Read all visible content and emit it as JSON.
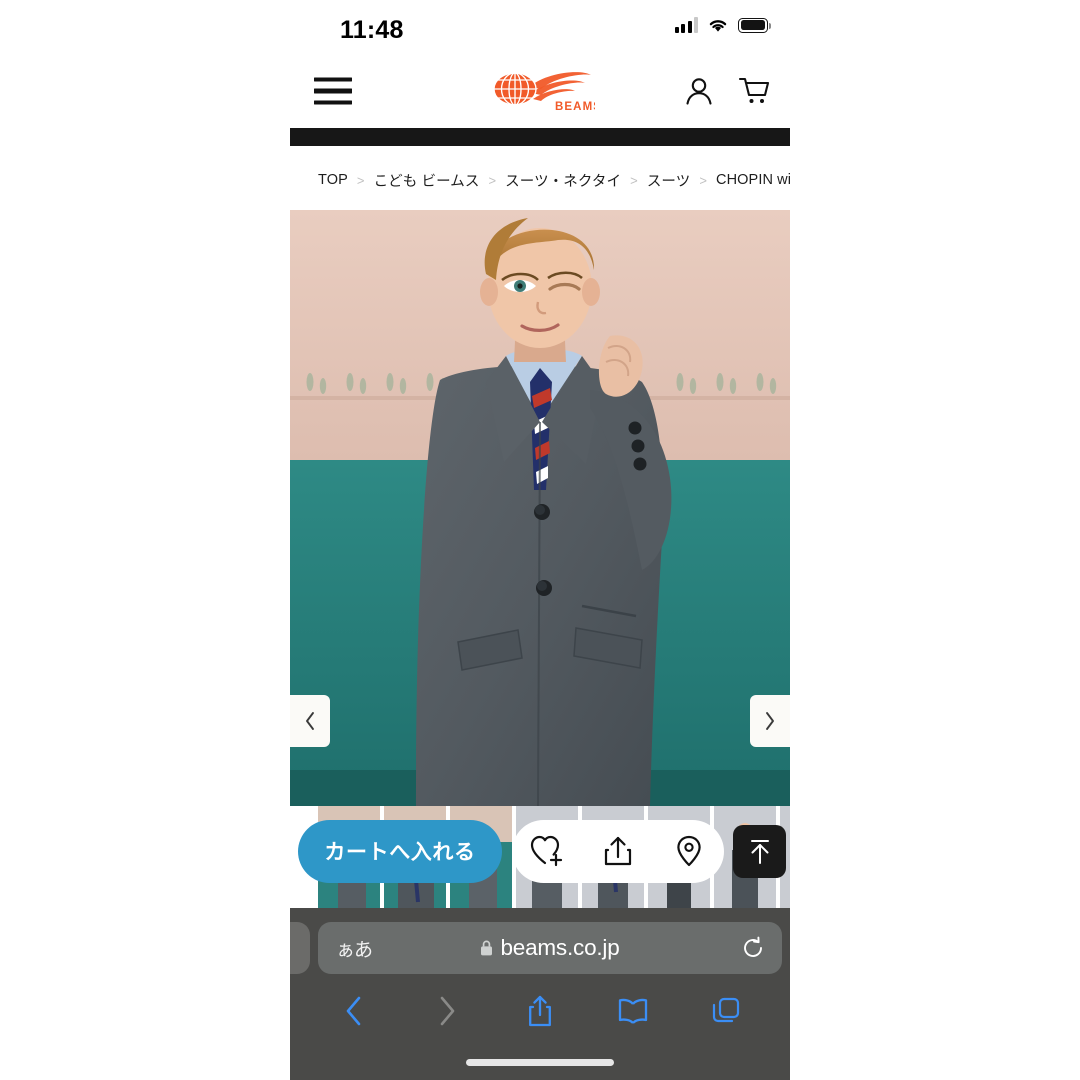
{
  "status_bar": {
    "time": "11:48",
    "signal_icon": "cellular-bars-icon",
    "wifi_icon": "wifi-icon",
    "battery_icon": "battery-full-icon"
  },
  "site_header": {
    "menu_icon": "hamburger-menu-icon",
    "logo_text": "BEAMS",
    "logo_icon": "beams-globe-logo-icon",
    "logo_color": "#F15A29",
    "account_icon": "person-icon",
    "cart_icon": "shopping-cart-icon"
  },
  "breadcrumb": {
    "separator": ">",
    "items": [
      {
        "label": "TOP"
      },
      {
        "label": "こども ビームス"
      },
      {
        "label": "スーツ・ネクタイ"
      },
      {
        "label": "スーツ"
      },
      {
        "label": "CHOPIN with K⋯"
      }
    ]
  },
  "gallery": {
    "prev_icon": "chevron-left-icon",
    "next_icon": "chevron-right-icon",
    "main_image_alt": "子どもモデル グレースーツ 着用画像",
    "thumbnail_count": 8
  },
  "action_bar": {
    "cart_label": "カートへ入れる",
    "cart_color": "#2E97C8",
    "favorite_icon": "heart-plus-icon",
    "share_icon": "share-upload-icon",
    "store_icon": "location-pin-icon",
    "scroll_top_icon": "arrow-up-to-line-icon"
  },
  "safari": {
    "text_size_label": "ぁあ",
    "lock_icon": "lock-icon",
    "url": "beams.co.jp",
    "reload_icon": "reload-icon",
    "back_icon": "chevron-left-icon",
    "forward_icon": "chevron-right-icon",
    "share_icon": "share-icon",
    "bookmarks_icon": "book-icon",
    "tabs_icon": "tabs-icon",
    "accent_color": "#3B8EF5",
    "disabled_color": "#8A8A88"
  }
}
